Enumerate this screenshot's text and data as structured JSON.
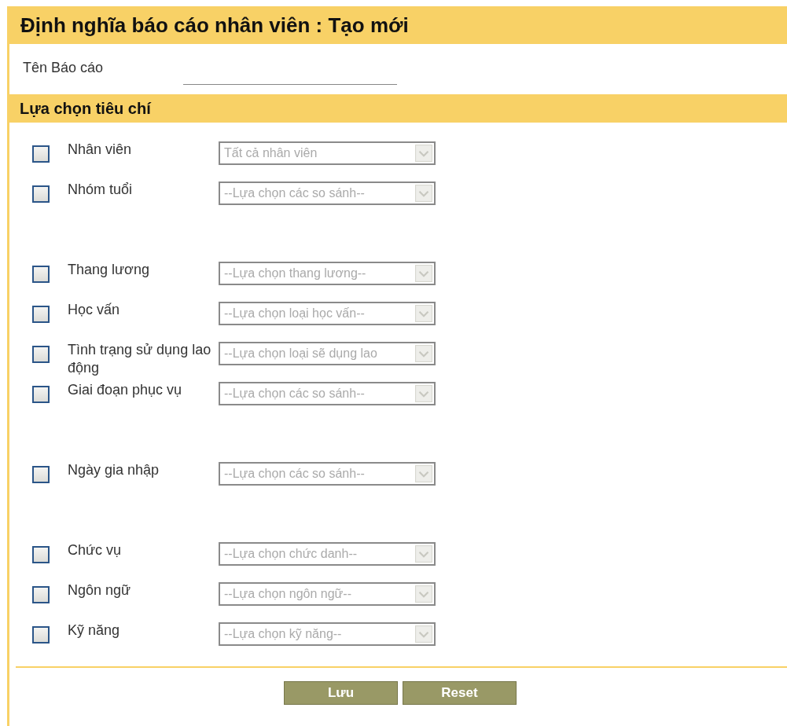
{
  "title": "Định nghĩa báo cáo nhân viên : Tạo mới",
  "report_name": {
    "label": "Tên Báo cáo"
  },
  "section_title": "Lựa chọn tiêu chí",
  "criteria_groups": [
    [
      {
        "label": "Nhân viên",
        "checked": false,
        "select": {
          "value": "Tất cả nhân viên",
          "disabled": true
        }
      },
      {
        "label": "Nhóm tuổi",
        "checked": false,
        "select": {
          "value": "--Lựa chọn các so sánh--",
          "disabled": true
        }
      }
    ],
    [
      {
        "label": "Thang lương",
        "checked": false,
        "select": {
          "value": "--Lựa chọn thang lương--",
          "disabled": true
        }
      },
      {
        "label": "Học vấn",
        "checked": false,
        "select": {
          "value": "--Lựa chọn loại học vấn--",
          "disabled": true
        }
      },
      {
        "label": "Tình trạng sử dụng lao động",
        "checked": false,
        "select": {
          "value": "--Lựa chọn loại sẽ dụng lao",
          "disabled": true
        }
      },
      {
        "label": "Giai đoạn phục vụ",
        "checked": false,
        "select": {
          "value": "--Lựa chọn các so sánh--",
          "disabled": true
        }
      }
    ],
    [
      {
        "label": "Ngày gia nhập",
        "checked": false,
        "select": {
          "value": "--Lựa chọn các so sánh--",
          "disabled": true
        }
      }
    ],
    [
      {
        "label": "Chức vụ",
        "checked": false,
        "select": {
          "value": "--Lựa chọn chức danh--",
          "disabled": true
        }
      },
      {
        "label": "Ngôn ngữ",
        "checked": false,
        "select": {
          "value": "--Lựa chọn ngôn ngữ--",
          "disabled": true
        }
      },
      {
        "label": "Kỹ năng",
        "checked": false,
        "select": {
          "value": "--Lựa chọn kỹ năng--",
          "disabled": true
        }
      }
    ]
  ],
  "buttons": [
    "Lưu",
    "Reset"
  ]
}
